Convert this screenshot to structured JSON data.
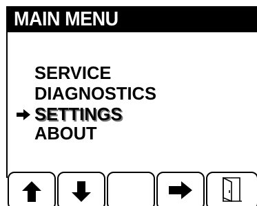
{
  "header": {
    "title": "MAIN MENU"
  },
  "menu": {
    "items": [
      {
        "label": "SERVICE",
        "selected": false
      },
      {
        "label": "DIAGNOSTICS",
        "selected": false
      },
      {
        "label": "SETTINGS",
        "selected": true
      },
      {
        "label": "ABOUT",
        "selected": false
      }
    ],
    "cursor_icon": "right-arrow-cursor-icon"
  },
  "softkeys": [
    {
      "icon": "up-arrow-icon"
    },
    {
      "icon": "down-arrow-icon"
    },
    {
      "icon": "blank"
    },
    {
      "icon": "right-arrow-icon"
    },
    {
      "icon": "exit-door-icon"
    }
  ],
  "colors": {
    "foreground": "#000000",
    "background": "#ffffff",
    "selected_shadow": "#7a7a7a"
  }
}
